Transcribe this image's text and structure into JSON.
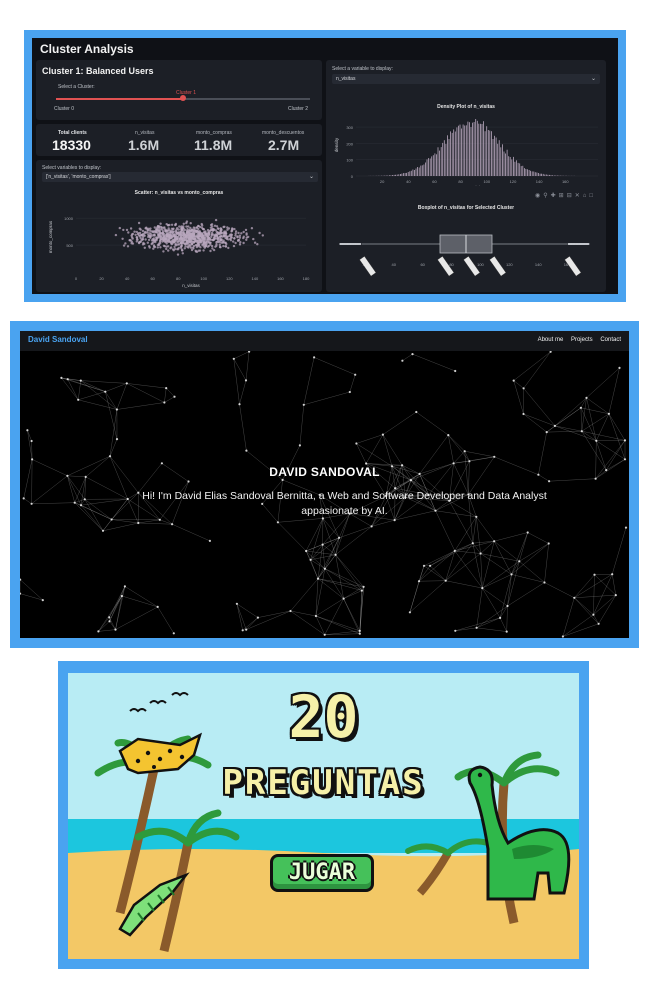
{
  "cluster_app": {
    "title": "Cluster Analysis",
    "cluster_heading": "Cluster 1: Balanced Users",
    "slider": {
      "label": "Select a Cluster:",
      "value": "Cluster 1",
      "value_fraction": 0.5,
      "min_label": "Cluster 0",
      "max_label": "Cluster 2"
    },
    "metrics": [
      {
        "label": "Total clients",
        "value": "18330"
      },
      {
        "label": "n_visitas",
        "value": "1.6M"
      },
      {
        "label": "monto_compras",
        "value": "11.8M"
      },
      {
        "label": "monto_descuentos",
        "value": "2.7M"
      }
    ],
    "multiselect": {
      "label": "Select variables to display:",
      "value": "['n_visitas', 'monto_compras']"
    },
    "scatter": {
      "title": "Scatter: n_visitas vs monto_compras",
      "xlabel": "n_visitas",
      "ylabel": "monto_compras"
    },
    "variable_select": {
      "label": "Select a variable to display:",
      "value": "n_visitas"
    },
    "density": {
      "title": "Density Plot of n_visitas",
      "xlabel": "n_visitas",
      "ylabel": "density"
    },
    "boxplot": {
      "title": "Boxplot of n_visitas for Selected Cluster"
    }
  },
  "chart_data": [
    {
      "type": "scatter",
      "title": "Scatter: n_visitas vs monto_compras",
      "xlabel": "n_visitas",
      "ylabel": "monto_compras",
      "xlim": [
        0,
        180
      ],
      "ylim": [
        0,
        1300
      ],
      "x_ticks": [
        "0",
        "20",
        "40",
        "60",
        "80",
        "100",
        "120",
        "140",
        "160",
        "180"
      ],
      "y_ticks": [
        "1000",
        "500"
      ],
      "cluster_center": {
        "x": 87,
        "y": 650
      },
      "x_spread": [
        8,
        165
      ],
      "y_spread": [
        230,
        1110
      ]
    },
    {
      "type": "area",
      "title": "Density Plot of n_visitas",
      "xlabel": "n_visitas",
      "ylabel": "density",
      "xlim": [
        0,
        185
      ],
      "ylim": [
        0,
        380
      ],
      "x_ticks": [
        "20",
        "40",
        "60",
        "80",
        "100",
        "120",
        "140",
        "160"
      ],
      "y_ticks": [
        "300",
        "200",
        "100",
        "0"
      ],
      "peak": {
        "x": 88,
        "y": 330
      }
    },
    {
      "type": "box",
      "title": "Boxplot of n_visitas for Selected Cluster",
      "xlim": [
        0,
        180
      ],
      "x_ticks": [
        "20",
        "40",
        "60",
        "80",
        "100",
        "120",
        "140",
        "160"
      ],
      "whisker_low": 18,
      "q1": 72,
      "median": 90,
      "q3": 108,
      "whisker_high": 160,
      "outliers_low": [
        3,
        17
      ],
      "outliers_high": [
        161,
        175
      ]
    }
  ],
  "portfolio": {
    "brand": "David Sandoval",
    "nav": [
      "About me",
      "Projects",
      "Contact"
    ],
    "hero_name": "DAVID SANDOVAL",
    "hero_text": "Hi! I'm David Elias Sandoval Bernitta, a Web and Software Developer and Data Analyst appasionate by AI."
  },
  "game": {
    "title_number": "20",
    "title_word": "PREGUNTAS",
    "play_label": "JUGAR",
    "colors": {
      "sky": "#b8ecf4",
      "sea": "#1cc6de",
      "sand": "#f3c866",
      "title": "#f6f0a8",
      "button": "#45c15a"
    }
  }
}
